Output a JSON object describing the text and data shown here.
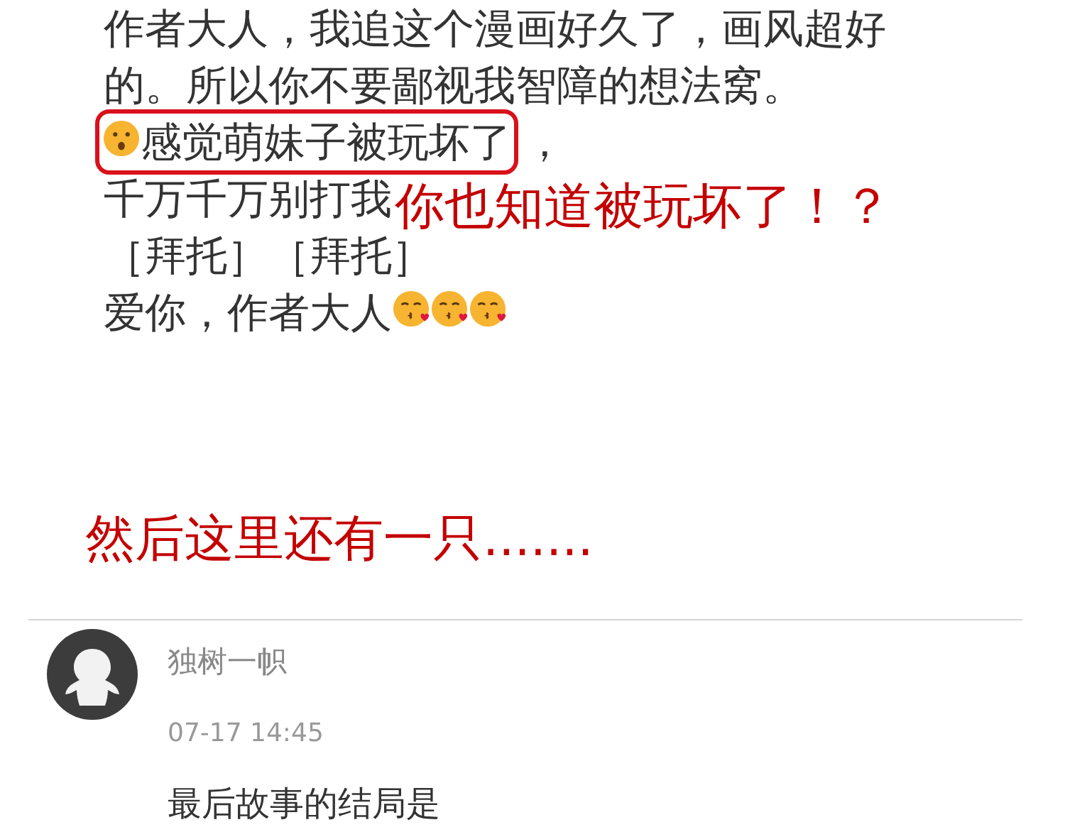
{
  "comment": {
    "lines": [
      {
        "parts": [
          {
            "kind": "text",
            "text": "作者大人，我追这个漫画好久了，画风超好"
          }
        ]
      },
      {
        "parts": [
          {
            "kind": "text",
            "text": "的。所以你不要鄙视我智障的想法窝。"
          }
        ]
      },
      {
        "circled_parts": [
          {
            "kind": "surprised-emoji"
          },
          {
            "kind": "text",
            "text": "感觉萌妹子被玩坏了"
          }
        ],
        "parts": [
          {
            "kind": "text",
            "text": "，"
          }
        ]
      },
      {
        "parts": [
          {
            "kind": "text",
            "text": "千万千万别打我"
          }
        ],
        "note": "你也知道被玩坏了！？"
      },
      {
        "parts": [
          {
            "kind": "text",
            "text": "［拜托］［拜托］"
          }
        ]
      },
      {
        "parts": [
          {
            "kind": "text",
            "text": "爱你，作者大人"
          },
          {
            "kind": "kiss-emoji"
          },
          {
            "kind": "kiss-emoji"
          },
          {
            "kind": "kiss-emoji"
          }
        ]
      }
    ]
  },
  "caption": "然后这里还有一只.......",
  "reply": {
    "user": "独树一帜",
    "time": "07-17 14:45",
    "text": "最后故事的结局是"
  }
}
